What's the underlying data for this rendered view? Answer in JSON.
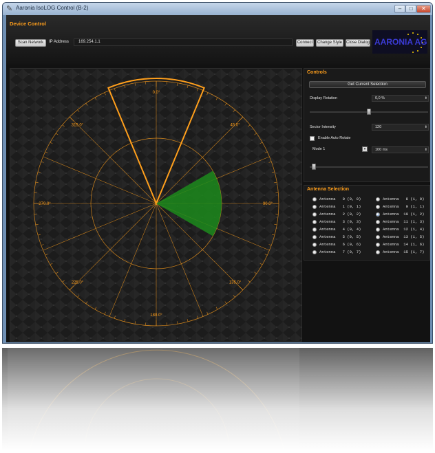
{
  "window": {
    "title": "Aaronia IsoLOG Control (B-2)",
    "controls": {
      "minimize": "–",
      "maximize": "□",
      "close": "✕"
    }
  },
  "device_control": {
    "title": "Device Control",
    "scan_label": "Scan Network",
    "ip_label": "IP Address",
    "ip_value": "169.254.1.1",
    "connect_label": "Connect",
    "change_style_label": "Change Style",
    "close_dialog_label": "Close Dialog",
    "logo_text": "AARONIA AG"
  },
  "radar": {
    "angle_labels": [
      "0.0°",
      "45.0°",
      "90.0°",
      "135.0°",
      "180.0°",
      "225.0°",
      "270.0°",
      "315.0°"
    ],
    "highlight_sector": {
      "start_deg": 60,
      "end_deg": 120
    }
  },
  "controls": {
    "title": "Controls",
    "get_selection_label": "Get Current Selection",
    "display_rotation_label": "Display Rotation",
    "display_rotation_value": "0,0 %",
    "rotation_slider_value": 0.5,
    "sector_intensity_label": "Sector Intensity",
    "sector_intensity_value": "120",
    "auto_rotate_label": "Enable Auto Rotate",
    "mode_value": "Mode 1",
    "interval_value": "100 ms",
    "interval_slider_value": 0.02
  },
  "antenna_selection": {
    "title": "Antenna Selection",
    "items": [
      {
        "label": "Antenna   0 (0, 0)",
        "selected": false
      },
      {
        "label": "Antenna   8 (1, 0)",
        "selected": false
      },
      {
        "label": "Antenna   1 (0, 1)",
        "selected": false
      },
      {
        "label": "Antenna   9 (1, 1)",
        "selected": false
      },
      {
        "label": "Antenna   2 (0, 2)",
        "selected": false
      },
      {
        "label": "Antenna  10 (1, 2)",
        "selected": true
      },
      {
        "label": "Antenna   3 (0, 3)",
        "selected": false
      },
      {
        "label": "Antenna  11 (1, 3)",
        "selected": false
      },
      {
        "label": "Antenna   4 (0, 4)",
        "selected": false
      },
      {
        "label": "Antenna  12 (1, 4)",
        "selected": false
      },
      {
        "label": "Antenna   5 (0, 5)",
        "selected": false
      },
      {
        "label": "Antenna  13 (1, 5)",
        "selected": false
      },
      {
        "label": "Antenna   6 (0, 6)",
        "selected": false
      },
      {
        "label": "Antenna  14 (1, 6)",
        "selected": false
      },
      {
        "label": "Antenna   7 (0, 7)",
        "selected": false
      },
      {
        "label": "Antenna  15 (1, 7)",
        "selected": false
      }
    ]
  },
  "colors": {
    "accent": "#ff9f1c",
    "sector_fill": "#1c8a1c",
    "window_frame": "#6f8fb3",
    "background": "#121212"
  }
}
